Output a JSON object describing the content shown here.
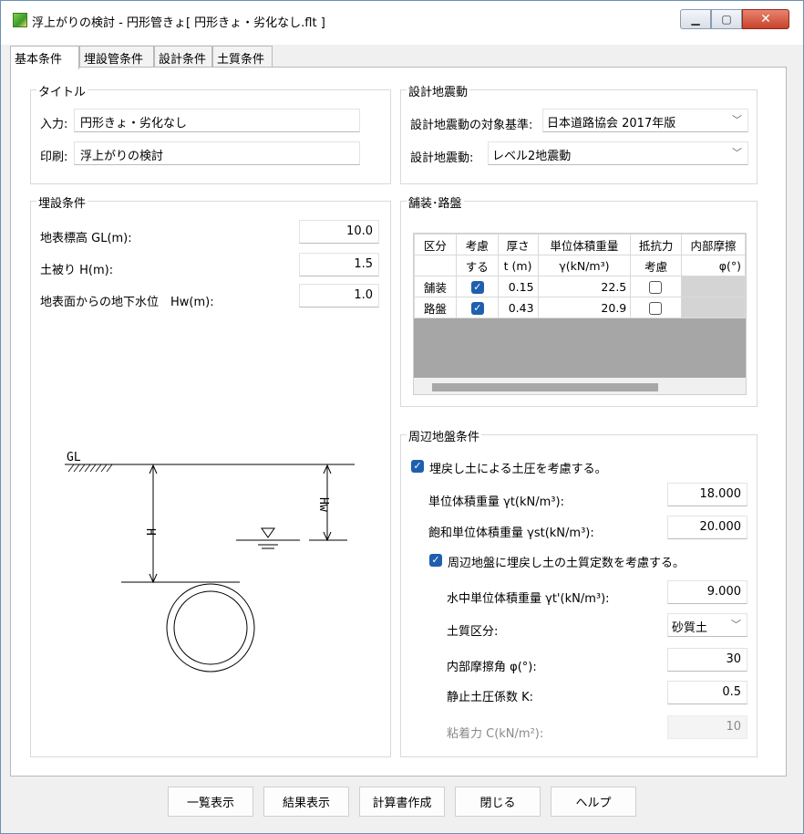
{
  "window": {
    "title": "浮上がりの検討 - 円形管きょ[ 円形きょ・劣化なし.flt ]"
  },
  "tabs": [
    "基本条件",
    "埋設管条件",
    "設計条件",
    "土質条件"
  ],
  "title_group": {
    "title": "タイトル",
    "input_label": "入力:",
    "input_value": "円形きょ・劣化なし",
    "print_label": "印刷:",
    "print_value": "浮上がりの検討"
  },
  "seismic": {
    "title": "設計地震動",
    "standard_label": "設計地震動の対象基準:",
    "standard_value": "日本道路協会 2017年版",
    "motion_label": "設計地震動:",
    "motion_value": "レベル2地震動"
  },
  "burial": {
    "title": "埋設条件",
    "gl_label": "地表標高 GL(m):",
    "gl_value": "10.0",
    "cover_label": "土被り H(m):",
    "cover_value": "1.5",
    "gw_label": "地表面からの地下水位　Hw(m):",
    "gw_value": "1.0"
  },
  "diagram": {
    "gl": "GL",
    "h": "H",
    "hw": "Hw"
  },
  "pavement": {
    "title": "舗装･路盤",
    "headers1": [
      "区分",
      "考慮",
      "厚さ",
      "単位体積重量",
      "抵抗力",
      "内部摩擦"
    ],
    "headers2": [
      "",
      "する",
      "t (m)",
      "γ(kN/m³)",
      "考慮",
      "φ(°)"
    ],
    "rows": [
      {
        "name": "舗装",
        "consider": true,
        "thickness": "0.15",
        "unit_weight": "22.5",
        "resist": false
      },
      {
        "name": "路盤",
        "consider": true,
        "thickness": "0.43",
        "unit_weight": "20.9",
        "resist": false
      }
    ]
  },
  "ground": {
    "title": "周辺地盤条件",
    "backfill_check": "埋戻し土による土圧を考慮する。",
    "unit_weight_label": "単位体積重量 γt(kN/m³):",
    "unit_weight_value": "18.000",
    "sat_weight_label": "飽和単位体積重量 γst(kN/m³):",
    "sat_weight_value": "20.000",
    "soil_const_check": "周辺地盤に埋戻し土の土質定数を考慮する。",
    "sub_weight_label": "水中単位体積重量 γt'(kN/m³):",
    "sub_weight_value": "9.000",
    "soil_type_label": "土質区分:",
    "soil_type_value": "砂質土",
    "friction_label": "内部摩擦角 φ(°):",
    "friction_value": "30",
    "k_label": "静止土圧係数 K:",
    "k_value": "0.5",
    "cohesion_label": "粘着力 C(kN/m²):",
    "cohesion_value": "10"
  },
  "buttons": [
    "一覧表示",
    "結果表示",
    "計算書作成",
    "閉じる",
    "ヘルプ"
  ]
}
